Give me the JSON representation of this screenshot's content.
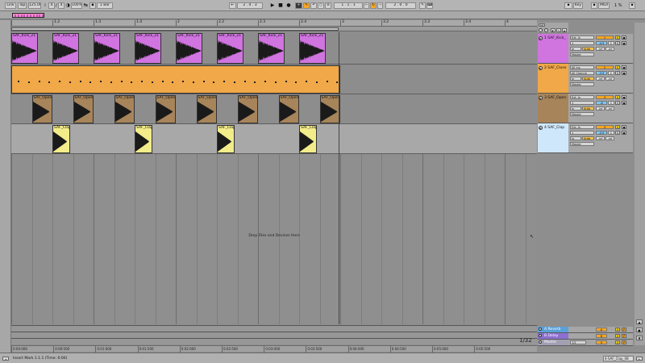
{
  "transport": {
    "link": "Link",
    "tap": "Tap",
    "tempo": "125.00",
    "sig_num": "4",
    "sig_den": "4",
    "zoom": "100%",
    "quantize": "1 Bar",
    "position": "2 . 4 . 3",
    "loop_start": "1 . 1 . 1",
    "loop_length": "2 . 0 . 0",
    "key": "Key",
    "midi": "MIDI",
    "cpu": "1 %"
  },
  "ruler": {
    "bars": [
      "",
      "1.2",
      "1.3",
      "1.4",
      "2",
      "2.2",
      "2.3",
      "2.4",
      "3",
      "3.2",
      "3.3",
      "3.4",
      "4"
    ]
  },
  "tracks": [
    {
      "number": "1",
      "name": "1 SAF_Kick_",
      "color": "#d074e0",
      "input": "Ext. In",
      "input2": "1",
      "monitor": "Auto",
      "output": "Master",
      "volume": "1",
      "pan": "-4.5",
      "send": "C",
      "clip_name": "SAF_Kick_21",
      "clip_color": "#d074e0"
    },
    {
      "number": "2",
      "name": "2 SAF_Close",
      "color": "#f0a848",
      "input": "All Ins",
      "input2": "All Channe",
      "monitor": "Auto",
      "output": "Master",
      "volume": "2",
      "pan": "-3.5",
      "send": "C",
      "clip_name": "",
      "clip_color": "#f0a848"
    },
    {
      "number": "3",
      "name": "3 SAF_Open",
      "color": "#a7845a",
      "input": "Ext. In",
      "input2": "1",
      "monitor": "Auto",
      "output": "Master",
      "volume": "3",
      "pan": "-8",
      "send": "C",
      "clip_name": "SAF_Open",
      "clip_color": "#a7845a"
    },
    {
      "number": "4",
      "name": "4 SAF_Clap",
      "color": "#cfe7fa",
      "input": "Ext. In",
      "input2": "1",
      "monitor": "Auto",
      "output": "Master",
      "volume": "4",
      "pan": "-2.0",
      "send": "C",
      "clip_name": "SAF_Clap",
      "clip_color": "#f2ec8a"
    }
  ],
  "returns": [
    {
      "name": "A Reverb",
      "color": "#5aa0d8",
      "volume": "A"
    },
    {
      "name": "B Delay",
      "color": "#8d6fd0",
      "volume": "B"
    },
    {
      "name": "Master",
      "color": "#a39fb3",
      "volume": "0",
      "output": "1/2"
    }
  ],
  "drop_hint": "Drop Files and Devices Here",
  "zoom_display": "1/32",
  "timeline": [
    "0:00:000",
    "0:00:500",
    "0:01:000",
    "0:01:500",
    "0:02:000",
    "0:02:500",
    "0:03:000",
    "0:03:500",
    "0:04:000",
    "0:04:500",
    "0:05:000",
    "0:05:500"
  ],
  "status": {
    "message": "Insert Mark 1.1.1 (Time: 0:00)",
    "right": "4-SAF_Clap_08"
  }
}
